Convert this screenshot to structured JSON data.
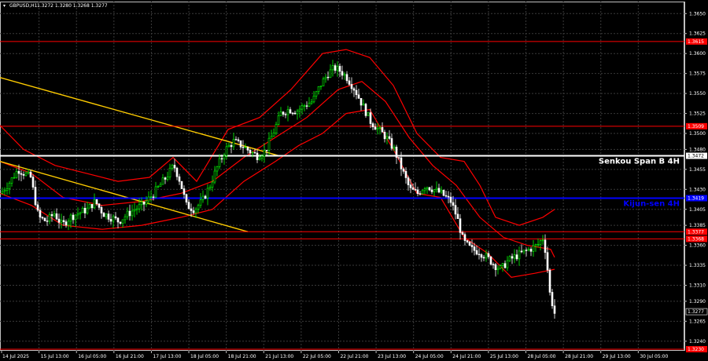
{
  "header": {
    "symbol_text": "GBPUSD,H1",
    "ohlc_text": "1.3272 1.3280 1.3268 1.3277"
  },
  "colors": {
    "background": "#000000",
    "grid": "#3a3a3a",
    "axis": "#c0c0c0",
    "candle_up": "#00ff00",
    "candle_down": "#ffffff",
    "ichimoku": "#ff0000",
    "trendline": "#ffcc00",
    "senkou": "#ffffff",
    "kijun": "#0000ff",
    "level": "#ff0000"
  },
  "chart_data": {
    "type": "candlestick",
    "ylim": [
      1.3228,
      1.3665
    ],
    "y_ticks": [
      "1.3650",
      "1.3625",
      "1.3600",
      "1.3575",
      "1.3550",
      "1.3525",
      "1.3500",
      "1.3480",
      "1.3455",
      "1.3430",
      "1.3405",
      "1.3385",
      "1.3360",
      "1.3335",
      "1.3310",
      "1.3290",
      "1.3265",
      "1.3240"
    ],
    "x_tick_labels": [
      "14 Jul 2025",
      "15 Jul 13:00",
      "16 Jul 05:00",
      "16 Jul 21:00",
      "17 Jul 13:00",
      "18 Jul 05:00",
      "18 Jul 21:00",
      "21 Jul 13:00",
      "22 Jul 05:00",
      "22 Jul 21:00",
      "23 Jul 13:00",
      "24 Jul 05:00",
      "24 Jul 21:00",
      "25 Jul 13:00",
      "28 Jul 05:00",
      "28 Jul 21:00",
      "29 Jul 13:00",
      "30 Jul 05:00"
    ],
    "levels": [
      {
        "price": 1.3615,
        "label": "1.3615",
        "color": "#ff0000",
        "kind": "level"
      },
      {
        "price": 1.3509,
        "label": "1.3509",
        "color": "#ff0000",
        "kind": "level"
      },
      {
        "price": 1.3472,
        "label": "1.3472",
        "color": "#ffffff",
        "kind": "senkou",
        "name": "Senkou Span B 4H"
      },
      {
        "price": 1.3419,
        "label": "1.3419",
        "color": "#0000ff",
        "kind": "kijun",
        "name": "Kijun-sen 4H"
      },
      {
        "price": 1.3377,
        "label": "1.3377",
        "color": "#ff0000",
        "kind": "level"
      },
      {
        "price": 1.3368,
        "label": "1.3368",
        "color": "#ff0000",
        "kind": "level"
      },
      {
        "price": 1.3277,
        "label": "1.3277",
        "color": "#ffffff",
        "kind": "current"
      },
      {
        "price": 1.323,
        "label": "1.3230",
        "color": "#ff0000",
        "kind": "level"
      }
    ],
    "close_path": [
      [
        0,
        1.3425
      ],
      [
        12,
        1.344
      ],
      [
        22,
        1.3455
      ],
      [
        30,
        1.345
      ],
      [
        38,
        1.3445
      ],
      [
        48,
        1.3395
      ],
      [
        58,
        1.339
      ],
      [
        68,
        1.34
      ],
      [
        78,
        1.3385
      ],
      [
        88,
        1.3395
      ],
      [
        98,
        1.34
      ],
      [
        110,
        1.3405
      ],
      [
        120,
        1.3415
      ],
      [
        130,
        1.34
      ],
      [
        140,
        1.3395
      ],
      [
        150,
        1.339
      ],
      [
        160,
        1.3398
      ],
      [
        170,
        1.3405
      ],
      [
        180,
        1.341
      ],
      [
        190,
        1.342
      ],
      [
        200,
        1.3432
      ],
      [
        210,
        1.3445
      ],
      [
        220,
        1.346
      ],
      [
        228,
        1.344
      ],
      [
        236,
        1.341
      ],
      [
        246,
        1.3405
      ],
      [
        256,
        1.3415
      ],
      [
        266,
        1.3435
      ],
      [
        276,
        1.346
      ],
      [
        286,
        1.348
      ],
      [
        296,
        1.349
      ],
      [
        306,
        1.3485
      ],
      [
        316,
        1.3478
      ],
      [
        326,
        1.3472
      ],
      [
        336,
        1.3478
      ],
      [
        346,
        1.35
      ],
      [
        356,
        1.3525
      ],
      [
        366,
        1.353
      ],
      [
        376,
        1.3528
      ],
      [
        386,
        1.3535
      ],
      [
        396,
        1.354
      ],
      [
        406,
        1.356
      ],
      [
        416,
        1.3575
      ],
      [
        424,
        1.3582
      ],
      [
        432,
        1.3578
      ],
      [
        440,
        1.357
      ],
      [
        450,
        1.3555
      ],
      [
        460,
        1.3535
      ],
      [
        470,
        1.3515
      ],
      [
        480,
        1.3505
      ],
      [
        490,
        1.3495
      ],
      [
        500,
        1.348
      ],
      [
        510,
        1.3455
      ],
      [
        520,
        1.343
      ],
      [
        530,
        1.3425
      ],
      [
        540,
        1.3435
      ],
      [
        550,
        1.343
      ],
      [
        560,
        1.3425
      ],
      [
        566,
        1.342
      ],
      [
        572,
        1.3415
      ],
      [
        580,
        1.3395
      ],
      [
        588,
        1.3365
      ],
      [
        598,
        1.3355
      ],
      [
        608,
        1.3352
      ],
      [
        618,
        1.3345
      ],
      [
        628,
        1.3335
      ],
      [
        636,
        1.333
      ],
      [
        644,
        1.334
      ],
      [
        652,
        1.3345
      ],
      [
        662,
        1.335
      ],
      [
        672,
        1.3355
      ],
      [
        682,
        1.336
      ],
      [
        690,
        1.337
      ],
      [
        694,
        1.334
      ],
      [
        698,
        1.33
      ],
      [
        704,
        1.3275
      ]
    ],
    "ichimoku_upper": [
      [
        0,
        1.351
      ],
      [
        30,
        1.348
      ],
      [
        70,
        1.346
      ],
      [
        110,
        1.345
      ],
      [
        150,
        1.344
      ],
      [
        190,
        1.3445
      ],
      [
        220,
        1.347
      ],
      [
        250,
        1.344
      ],
      [
        290,
        1.3505
      ],
      [
        330,
        1.352
      ],
      [
        370,
        1.3555
      ],
      [
        410,
        1.36
      ],
      [
        440,
        1.3605
      ],
      [
        470,
        1.3595
      ],
      [
        500,
        1.356
      ],
      [
        530,
        1.35
      ],
      [
        560,
        1.347
      ],
      [
        590,
        1.3465
      ],
      [
        610,
        1.3435
      ],
      [
        630,
        1.3395
      ],
      [
        660,
        1.3385
      ],
      [
        690,
        1.3395
      ],
      [
        705,
        1.3405
      ]
    ],
    "ichimoku_mid": [
      [
        0,
        1.3465
      ],
      [
        40,
        1.345
      ],
      [
        80,
        1.342
      ],
      [
        130,
        1.341
      ],
      [
        180,
        1.3415
      ],
      [
        230,
        1.3425
      ],
      [
        270,
        1.344
      ],
      [
        310,
        1.347
      ],
      [
        350,
        1.3495
      ],
      [
        390,
        1.352
      ],
      [
        430,
        1.3555
      ],
      [
        460,
        1.3565
      ],
      [
        490,
        1.354
      ],
      [
        520,
        1.3495
      ],
      [
        550,
        1.346
      ],
      [
        580,
        1.3435
      ],
      [
        610,
        1.3395
      ],
      [
        640,
        1.337
      ],
      [
        670,
        1.336
      ],
      [
        700,
        1.3355
      ],
      [
        705,
        1.3345
      ]
    ],
    "ichimoku_lower": [
      [
        0,
        1.3425
      ],
      [
        40,
        1.341
      ],
      [
        80,
        1.3385
      ],
      [
        130,
        1.338
      ],
      [
        180,
        1.3385
      ],
      [
        230,
        1.3395
      ],
      [
        270,
        1.3405
      ],
      [
        310,
        1.344
      ],
      [
        350,
        1.3465
      ],
      [
        380,
        1.3485
      ],
      [
        410,
        1.35
      ],
      [
        440,
        1.3525
      ],
      [
        470,
        1.353
      ],
      [
        500,
        1.348
      ],
      [
        530,
        1.3425
      ],
      [
        560,
        1.342
      ],
      [
        590,
        1.337
      ],
      [
        620,
        1.335
      ],
      [
        650,
        1.332
      ],
      [
        680,
        1.3325
      ],
      [
        705,
        1.333
      ]
    ],
    "trendlines": [
      {
        "x1": 0,
        "y1": 1.357,
        "x2": 355,
        "y2": 1.3472
      },
      {
        "x1": 0,
        "y1": 1.3465,
        "x2": 315,
        "y2": 1.3377
      }
    ]
  }
}
